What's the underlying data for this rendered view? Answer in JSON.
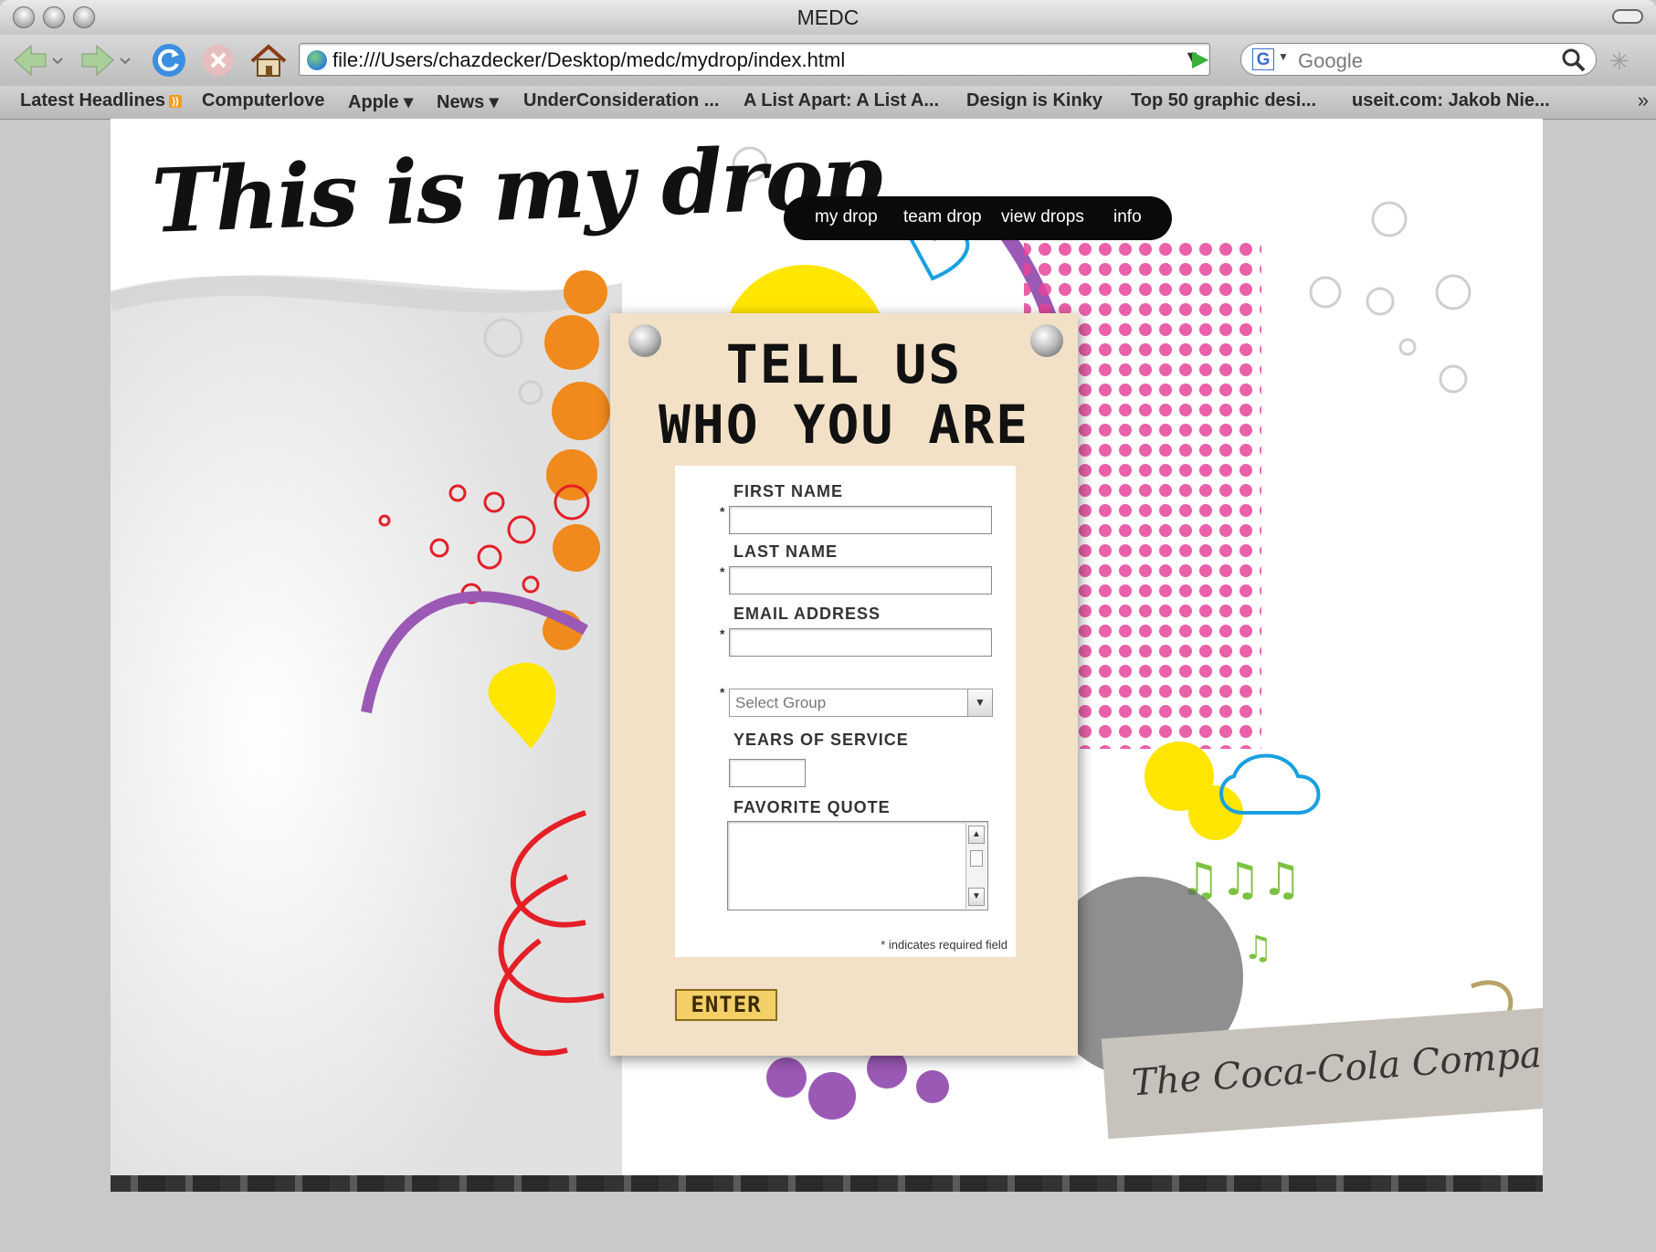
{
  "window": {
    "title": "MEDC"
  },
  "toolbar": {
    "url": "file:///Users/chazdecker/Desktop/medc/mydrop/index.html",
    "search_placeholder": "Google",
    "search_engine_badge": "G"
  },
  "bookmarks": [
    {
      "label": "Latest Headlines"
    },
    {
      "label": "Computerlove"
    },
    {
      "label": "Apple ▾"
    },
    {
      "label": "News ▾"
    },
    {
      "label": "UnderConsideration ..."
    },
    {
      "label": "A List Apart: A List A..."
    },
    {
      "label": "Design is Kinky"
    },
    {
      "label": "Top 50 graphic desi..."
    },
    {
      "label": "useit.com: Jakob Nie..."
    }
  ],
  "site": {
    "logo": "This is my drop",
    "nav": [
      "my drop",
      "team drop",
      "view drops",
      "info"
    ],
    "brand": "The Coca-Cola Company"
  },
  "form": {
    "title_line1": "TELL US",
    "title_line2": "WHO YOU ARE",
    "first_name_label": "FIRST NAME",
    "last_name_label": "LAST NAME",
    "email_label": "EMAIL ADDRESS",
    "group_select": "Select Group",
    "years_label": "YEARS OF SERVICE",
    "quote_label": "FAVORITE QUOTE",
    "required_marker": "*",
    "required_note": "* indicates required field",
    "submit_label": "ENTER"
  },
  "colors": {
    "card": "#f2e1c7",
    "button": "#f3cf67",
    "nav_bg": "#0a0a0a",
    "accent_pink": "#e6449a",
    "accent_orange": "#f08a1c",
    "accent_yellow": "#ffe600",
    "accent_purple": "#9b59b6",
    "accent_red": "#e41f26"
  }
}
